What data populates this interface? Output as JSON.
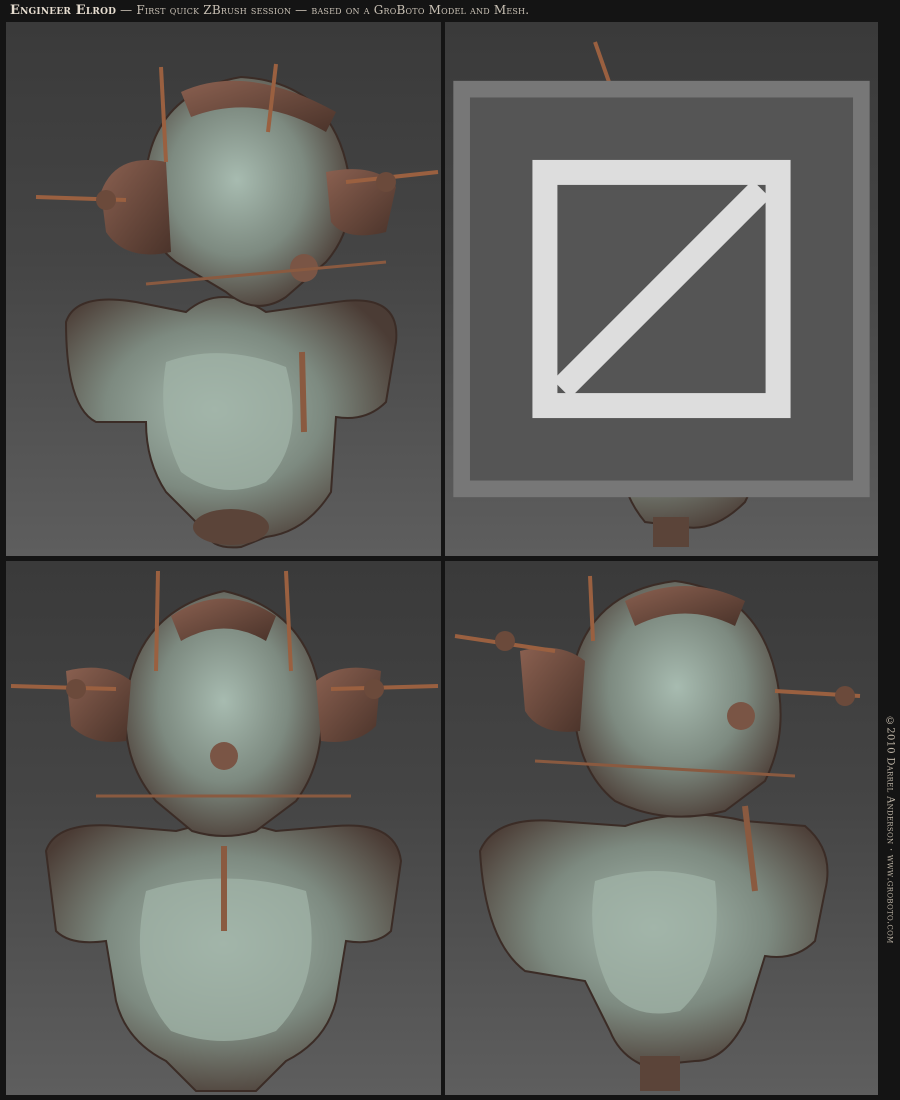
{
  "header": {
    "title": "Engineer Elrod",
    "subtitle": " — First quick ZBrush session — based on a GroBoto Model and Mesh."
  },
  "copyright": "©2010 Darrel Anderson · www.groboto.com",
  "panels": [
    {
      "view": "front-three-quarter-view"
    },
    {
      "view": "right-side-view",
      "icon": "view-toggle-icon"
    },
    {
      "view": "front-view"
    },
    {
      "view": "left-three-quarter-view"
    }
  ],
  "colors": {
    "background": "#141414",
    "panel_top": "#3a3a3a",
    "panel_bottom": "#5e5e5e",
    "model_copper": "#7a5545",
    "model_teal": "#8fa59a",
    "antenna": "#9a6040"
  }
}
